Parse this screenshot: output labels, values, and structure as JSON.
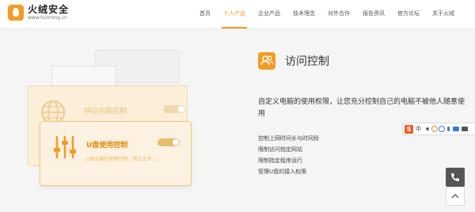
{
  "brand": {
    "name": "火绒安全",
    "url": "www.huorong.cn"
  },
  "nav": [
    {
      "label": "首页",
      "active": false
    },
    {
      "label": "个人产品",
      "active": true
    },
    {
      "label": "企业产品",
      "active": false
    },
    {
      "label": "技术理念",
      "active": false
    },
    {
      "label": "对外合作",
      "active": false
    },
    {
      "label": "报告资讯",
      "active": false
    },
    {
      "label": "官方论坛",
      "active": false
    },
    {
      "label": "关于火绒",
      "active": false
    }
  ],
  "illustration": {
    "card_back": {
      "title": "网站内容控制"
    },
    "card_front": {
      "title": "U盘使用控制",
      "desc": "U盘设备的管理控制，禁止文件……"
    }
  },
  "feature": {
    "title": "访问控制",
    "description": "自定义电脑的使用权限，让您充分控制自己的电脑不被他人随意使用",
    "items": [
      "控制上网时间长与时间段",
      "限制访问指定网站",
      "限制指定程序运行",
      "管理U盘的接入权限"
    ]
  },
  "ime": {
    "logo": "S",
    "label": "中"
  },
  "colors": {
    "accent": "#f59a23"
  },
  "icons": [
    "globe-icon",
    "control-sliders-icon",
    "users-icon",
    "phone-icon",
    "arrow-up-icon"
  ]
}
